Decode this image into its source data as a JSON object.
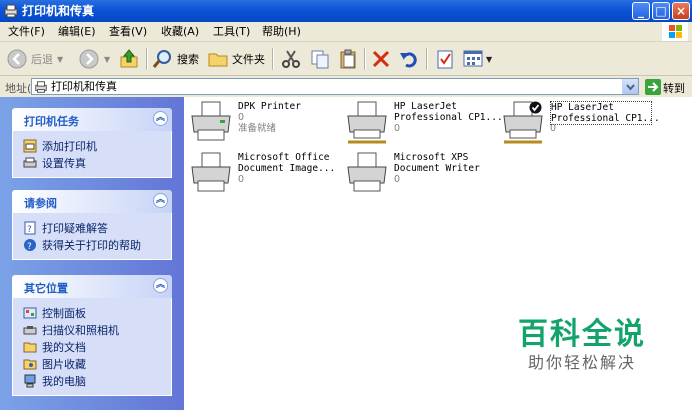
{
  "window": {
    "title": "打印机和传真"
  },
  "menu": [
    "文件(F)",
    "编辑(E)",
    "查看(V)",
    "收藏(A)",
    "工具(T)",
    "帮助(H)"
  ],
  "toolbar": {
    "back": "后退",
    "search": "搜索",
    "folders": "文件夹"
  },
  "address": {
    "label": "地址(D)",
    "value": "打印机和传真",
    "go": "转到"
  },
  "sidebar": {
    "printer_tasks": {
      "title": "打印机任务",
      "items": [
        "添加打印机",
        "设置传真"
      ]
    },
    "see_also": {
      "title": "请参阅",
      "items": [
        "打印疑难解答",
        "获得关于打印的帮助"
      ]
    },
    "other_places": {
      "title": "其它位置",
      "items": [
        "控制面板",
        "扫描仪和照相机",
        "我的文档",
        "图片收藏",
        "我的电脑"
      ]
    }
  },
  "printers": [
    {
      "name": "DPK Printer",
      "docs": "0",
      "status": "准备就绪"
    },
    {
      "name": "HP LaserJet\nProfessional CP1...",
      "docs": "0",
      "status": ""
    },
    {
      "name": "HP LaserJet\nProfessional CP1...",
      "docs": "0",
      "status": "",
      "default": true
    },
    {
      "name": "Microsoft Office\nDocument Image...",
      "docs": "0",
      "status": ""
    },
    {
      "name": "Microsoft XPS\nDocument Writer",
      "docs": "0",
      "status": ""
    }
  ],
  "watermark": {
    "title": "百科全说",
    "subtitle": "助你轻松解决"
  },
  "colors": {
    "titlebar": "#0a54d6",
    "sidebar": "#7ba2e7",
    "link": "#0a246a",
    "panel_title": "#215dc6",
    "watermark": "#12a46b"
  }
}
